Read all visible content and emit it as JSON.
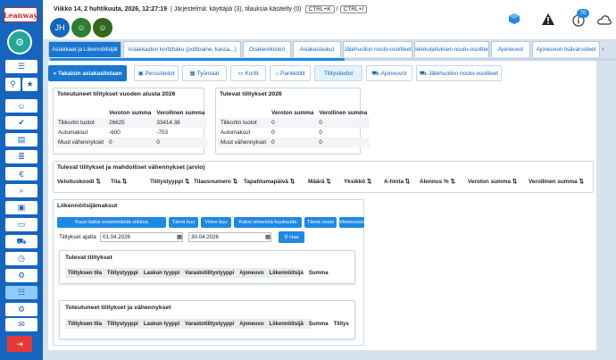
{
  "app": {
    "logo_text": "Leanway"
  },
  "header": {
    "datetime": "Viikko 14, 2 huhtikuuta, 2026, 12:27:19",
    "system_label": "Järjestelmä:",
    "system_status": "käyttäjiä (3), tilauksia käsitelty (0)",
    "shortcut1": "CTRL+K",
    "shortcut_sep": "/",
    "shortcut2": "CTRL+I",
    "avatar1_initials": "JH",
    "notification_count": "70"
  },
  "tabs": [
    "Asiakkaat ja Liikennöitsijät",
    "Asiakkaiden korttihaku (polttoaine, kassa...)",
    "Osakerekisteri",
    "Asiakaslaskut",
    "Jätehuollon nouto-osoitteet",
    "Lietekuljetuksen nouto-osoitteet",
    "Ajoneuvot",
    "Ajoneuvon lisävarusteet"
  ],
  "subnav": {
    "back": "Takaisin asiakaslistaan",
    "items": [
      "Perustiedot",
      "Työmaat",
      "Kortit",
      "Pankkitilit",
      "Tilitystiedot",
      "Ajoneuvot",
      "Jätehuollon nouto-osoitteet"
    ]
  },
  "realized_panel": {
    "title": "Toteutuneet tilitykset vuoden alusta 2026",
    "headers": [
      "",
      "Veroton summa",
      "Verollinen summa"
    ],
    "rows": [
      [
        "Tilikortin tuotot",
        "26625",
        "33414.38"
      ],
      [
        "Automaksut",
        "-600",
        "-753"
      ],
      [
        "Muut vähennykset",
        "0",
        "0"
      ]
    ]
  },
  "upcoming_panel": {
    "title": "Tulevat tilitykset 2026",
    "headers": [
      "",
      "Veroton summa",
      "Verollinen summa"
    ],
    "rows": [
      [
        "Tilikortin tuotot",
        "0",
        "0"
      ],
      [
        "Automaksut",
        "0",
        "0"
      ],
      [
        "Muut vähennykset",
        "0",
        "0"
      ]
    ]
  },
  "estimate_panel": {
    "title": "Tulevat tilitykset ja mahdolliset vähennykset (arvio)",
    "columns": [
      "Veloituskoodi",
      "Tila",
      "Tilitystyyppi",
      "Tilausnumero",
      "Tapahtumapäivä",
      "Määrä",
      "Yksikkö",
      "A-hinta",
      "Alennus %",
      "Veroton summa",
      "Verollinen summa"
    ],
    "sort_glyph": "⇅"
  },
  "operator_panel": {
    "title": "Liikennöitsijämaksut",
    "buttons": [
      "Kuun kaksi ensimmäistä viikkoa",
      "Tämä kuu",
      "Viime kuu",
      "Kaksi viimeistä kuukautta",
      "Tämä vuosi",
      "Viimevuosi"
    ],
    "date_label": "Tilitykset ajalta",
    "date_from": "01.04.2026",
    "date_to": "30.04.2026",
    "search_label": "Hae",
    "upcoming_title": "Tulevat tilitykset",
    "upcoming_columns": [
      "Tilityksen tila",
      "Tilitystyyppi",
      "Laskun tyyppi",
      "Varastotilitystyyppi",
      "Ajoneuvo",
      "Liikennöitsijä",
      "Summa"
    ],
    "realized_title": "Toteutuneet tilitykset ja vähennykset",
    "realized_columns": [
      "Tilityksen tila",
      "Tilitystyyppi",
      "Laskun tyyppi",
      "Varastotilitystyyppi",
      "Ajoneuvo",
      "Liikennöitsijä",
      "Summa",
      "Tilitys"
    ]
  }
}
